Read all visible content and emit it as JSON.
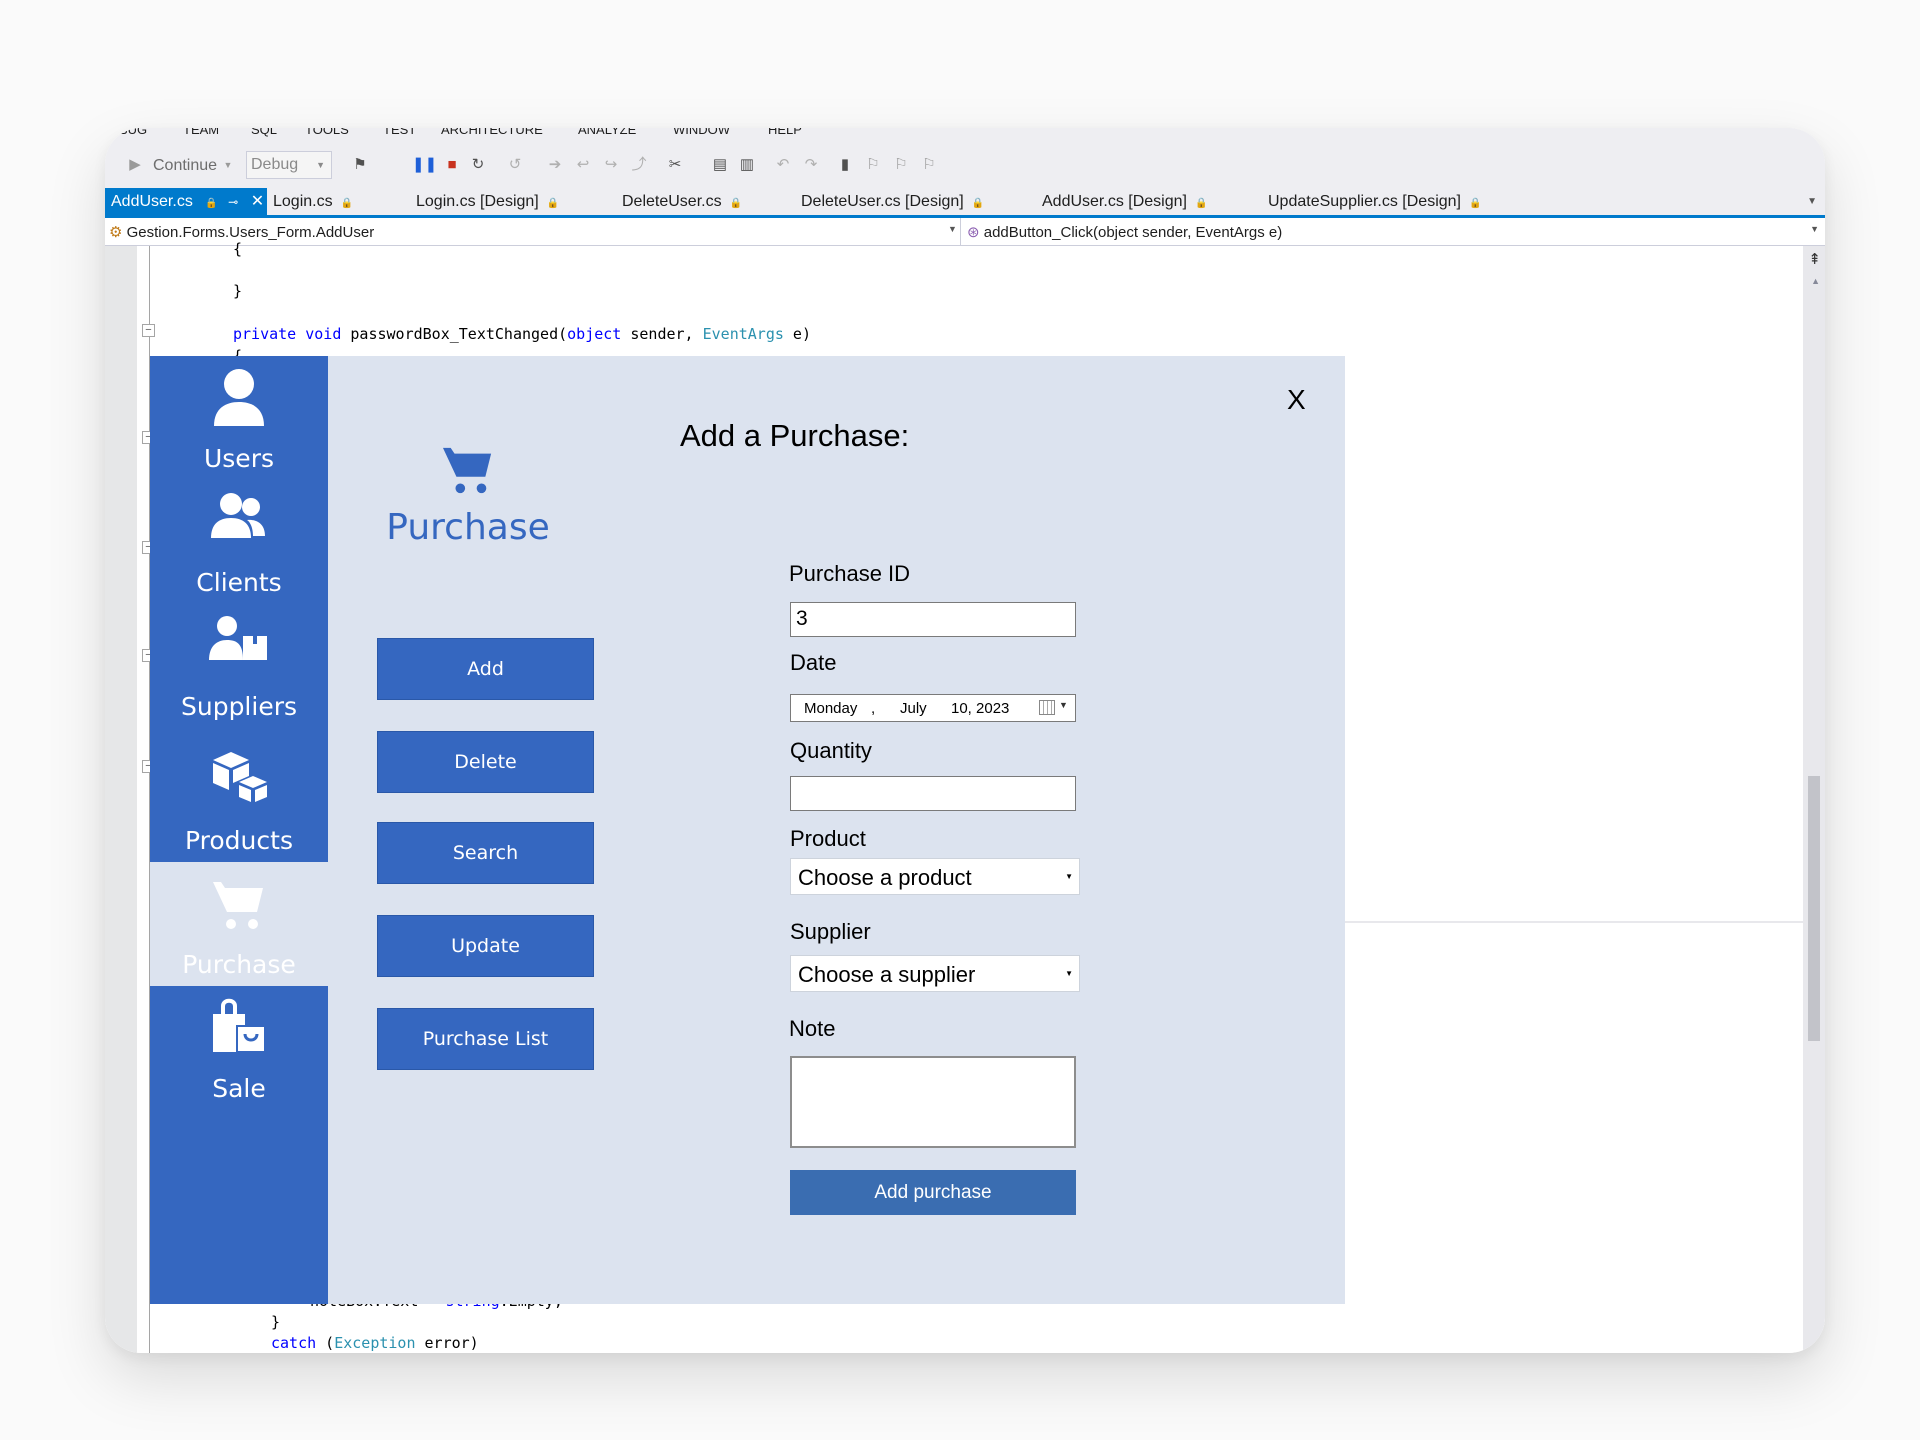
{
  "ide": {
    "menu": [
      "BUG",
      "TEAM",
      "SQL",
      "TOOLS",
      "TEST",
      "ARCHITECTURE",
      "ANALYZE",
      "WINDOW",
      "HELP"
    ],
    "toolbar": {
      "continue_label": "Continue",
      "config_value": "Debug"
    },
    "tabs": [
      {
        "label": "AddUser.cs",
        "active": true
      },
      {
        "label": "Login.cs",
        "active": false
      },
      {
        "label": "Login.cs [Design]",
        "active": false
      },
      {
        "label": "DeleteUser.cs",
        "active": false
      },
      {
        "label": "DeleteUser.cs [Design]",
        "active": false
      },
      {
        "label": "AddUser.cs [Design]",
        "active": false
      },
      {
        "label": "UpdateSupplier.cs [Design]",
        "active": false
      }
    ],
    "nav_left": "Gestion.Forms.Users_Form.AddUser",
    "nav_right": "addButton_Click(object sender, EventArgs e)",
    "code": {
      "line1": "{",
      "line2": "}",
      "line3": {
        "kw1": "private",
        "kw2": "void",
        "name": " passwordBox_TextChanged(",
        "kw3": "object",
        "mid": " sender, ",
        "ty": "EventArgs",
        "end": " e)"
      },
      "line4": "{",
      "line5": {
        "pre": "noteBox.Text = ",
        "kw": "string",
        "post": ".Empty;"
      },
      "line6": "}",
      "line7": {
        "kw": "catch",
        "pre": " (",
        "ty": "Exception",
        "post": " error)"
      }
    }
  },
  "app": {
    "sidebar": [
      {
        "label": "Users",
        "icon": "user-icon"
      },
      {
        "label": "Clients",
        "icon": "clients-icon"
      },
      {
        "label": "Suppliers",
        "icon": "supplier-icon"
      },
      {
        "label": "Products",
        "icon": "products-icon"
      },
      {
        "label": "Purchase",
        "icon": "cart-icon",
        "active": true
      },
      {
        "label": "Sale",
        "icon": "shopping-bag-icon"
      }
    ],
    "logo_label": "Purchase",
    "actions": [
      "Add",
      "Delete",
      "Search",
      "Update",
      "Purchase List"
    ],
    "close_label": "X",
    "form": {
      "title": "Add a Purchase:",
      "purchase_id_label": "Purchase ID",
      "purchase_id_value": "3",
      "date_label": "Date",
      "date": {
        "weekday": "Monday",
        "sep": ",",
        "month": "July",
        "day_year": "10, 2023"
      },
      "quantity_label": "Quantity",
      "quantity_value": "",
      "product_label": "Product",
      "product_value": "Choose a product",
      "supplier_label": "Supplier",
      "supplier_value": "Choose a supplier",
      "note_label": "Note",
      "submit_label": "Add purchase"
    },
    "colors": {
      "primary": "#3567c0",
      "panel": "#dce3ef",
      "submit": "#3a6db1",
      "ide_accent": "#007acc"
    }
  }
}
